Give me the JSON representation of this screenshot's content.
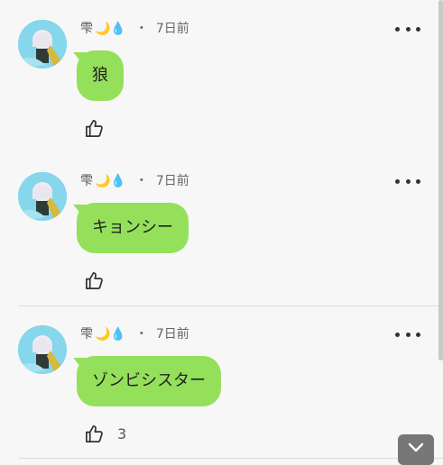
{
  "comments": [
    {
      "user": "雫",
      "emoji": "🌙💧",
      "separator": "・",
      "time": "7日前",
      "text": "狼",
      "likes": ""
    },
    {
      "user": "雫",
      "emoji": "🌙💧",
      "separator": "・",
      "time": "7日前",
      "text": "キョンシー",
      "likes": ""
    },
    {
      "user": "雫",
      "emoji": "🌙💧",
      "separator": "・",
      "time": "7日前",
      "text": "ゾンビシスター",
      "likes": "3"
    }
  ],
  "icons": {
    "more": "more-options-icon",
    "like": "thumbs-up-icon",
    "scroll_down": "chevron-down-icon"
  },
  "colors": {
    "bubble": "#94e05b",
    "background": "#f7f7f7"
  }
}
